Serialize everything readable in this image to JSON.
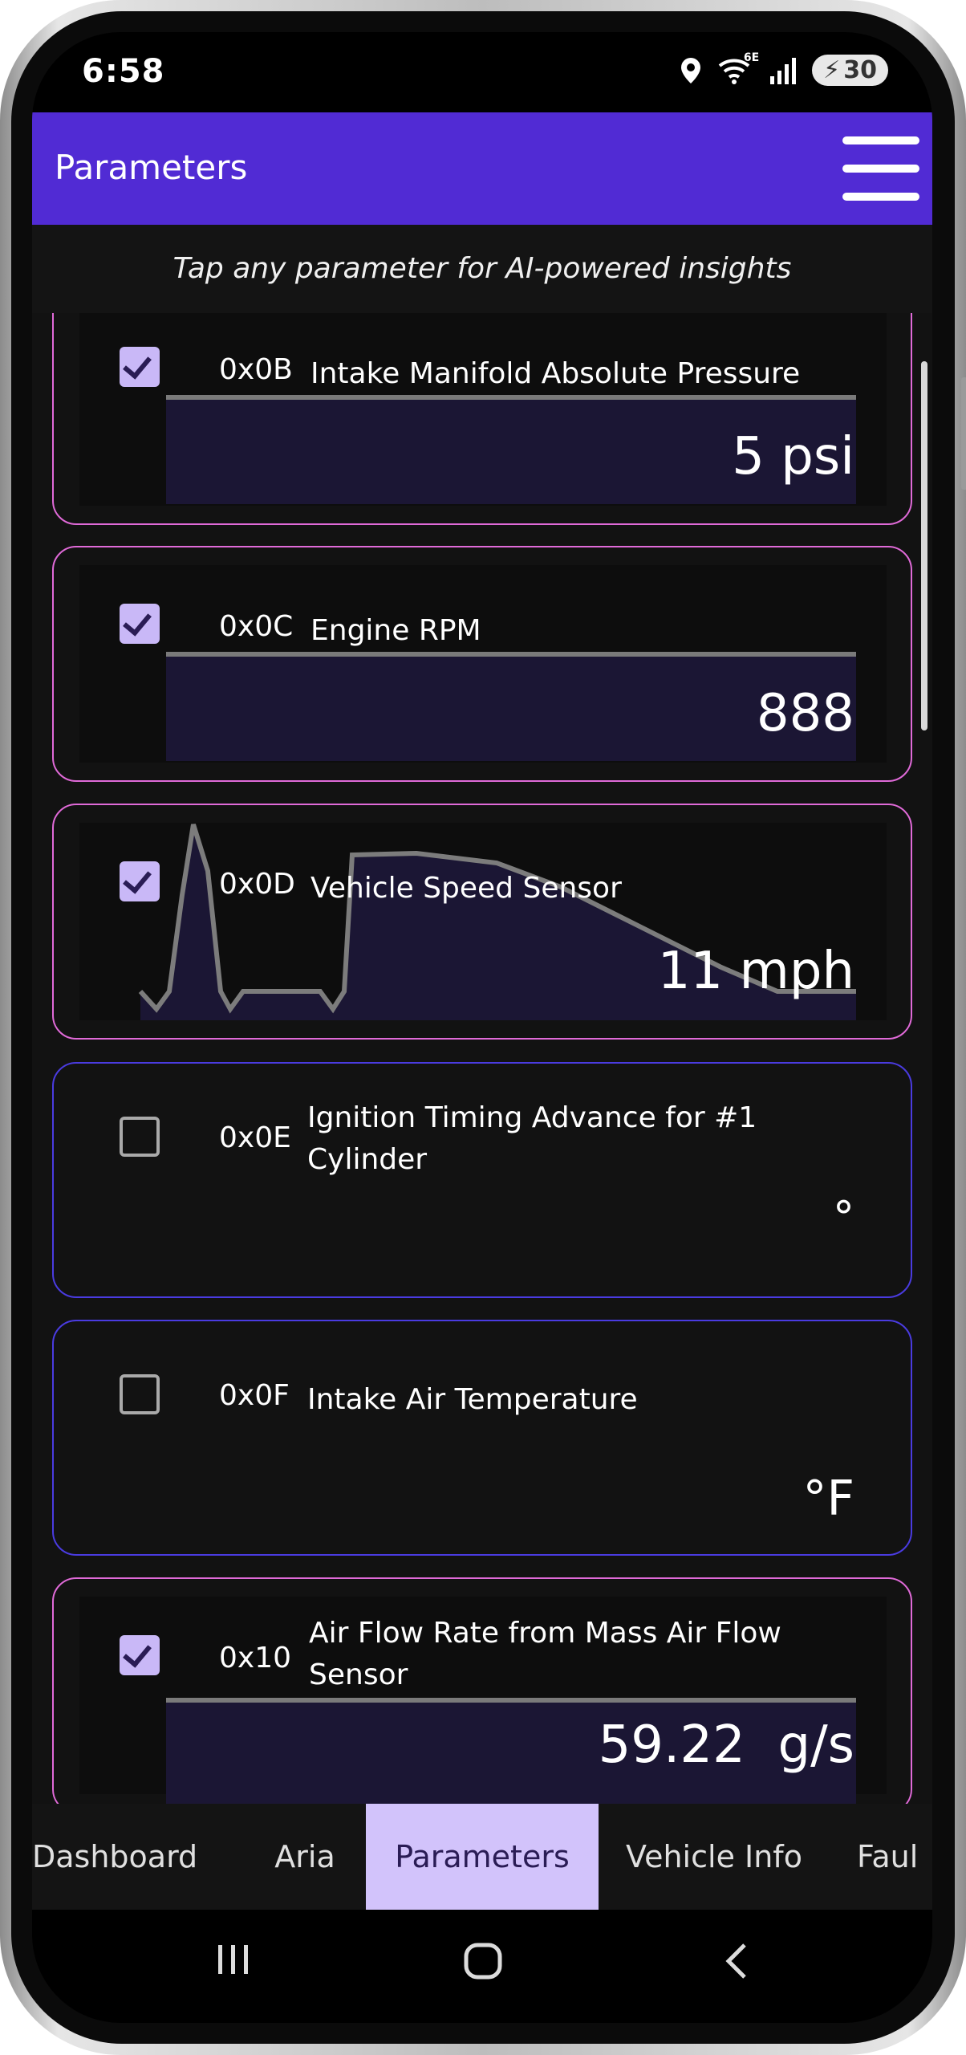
{
  "status_bar": {
    "time": "6:58",
    "battery": "30",
    "network": "6E"
  },
  "app_bar": {
    "title": "Parameters"
  },
  "hint": "Tap any parameter for AI-powered insights",
  "parameters": [
    {
      "pid": "0x0B",
      "name": "Intake Manifold Absolute Pressure",
      "value": "5 psi",
      "checked": true,
      "graph": "bar"
    },
    {
      "pid": "0x0C",
      "name": "Engine RPM",
      "value": "888",
      "checked": true,
      "graph": "bar"
    },
    {
      "pid": "0x0D",
      "name": "Vehicle Speed Sensor",
      "value": "11 mph",
      "checked": true,
      "graph": "line"
    },
    {
      "pid": "0x0E",
      "name": "Ignition Timing Advance for #1 Cylinder",
      "value": "°",
      "checked": false,
      "graph": "none"
    },
    {
      "pid": "0x0F",
      "name": "Intake Air Temperature",
      "value": "°F",
      "checked": false,
      "graph": "none"
    },
    {
      "pid": "0x10",
      "name": "Air Flow Rate from Mass Air Flow Sensor",
      "value": "59.22  g/s",
      "checked": true,
      "graph": "bar"
    }
  ],
  "tabs": [
    {
      "label": "Dashboard",
      "active": false
    },
    {
      "label": "Aria",
      "active": false
    },
    {
      "label": "Parameters",
      "active": true
    },
    {
      "label": "Vehicle Info",
      "active": false
    },
    {
      "label": "Faul",
      "active": false
    }
  ],
  "colors": {
    "accent": "#512bd4",
    "selected_border": "#e06ad8",
    "unselected_border": "#4a3be0",
    "active_tab": "#d2c3fb"
  }
}
